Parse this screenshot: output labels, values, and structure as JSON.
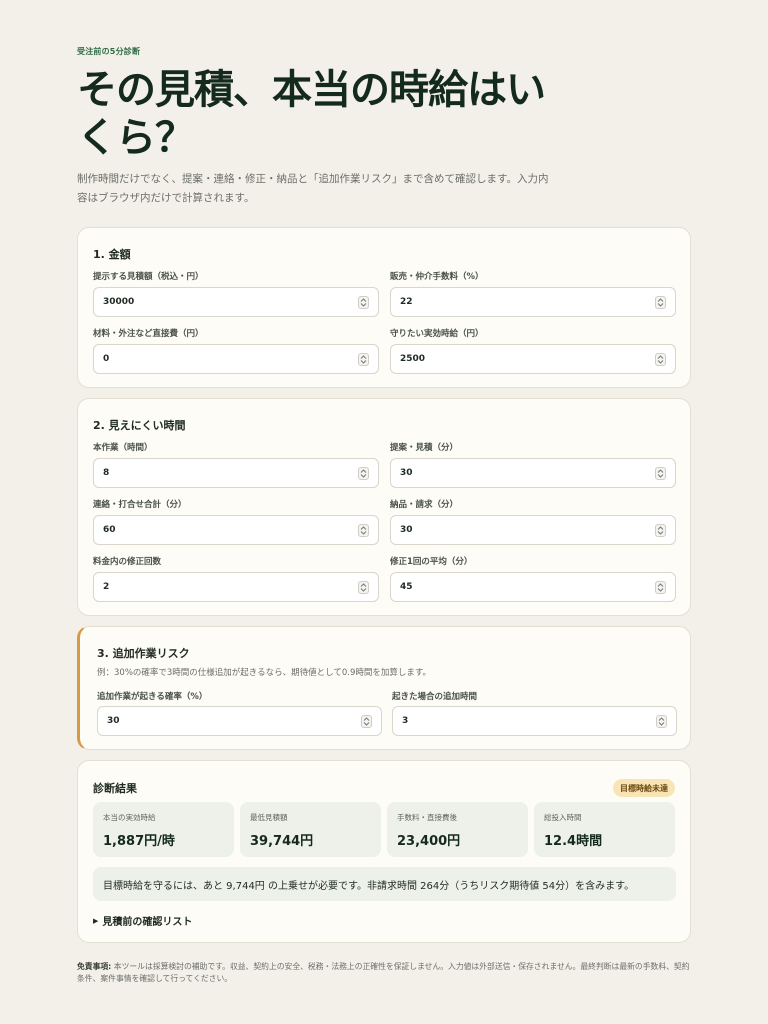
{
  "header": {
    "eyebrow": "受注前の5分診断",
    "title": "その見積、本当の時給はいくら？",
    "lead": "制作時間だけでなく、提案・連絡・修正・納品と「追加作業リスク」まで含めて確認します。入力内容はブラウザ内だけで計算されます。"
  },
  "section1": {
    "title": "1. 金額",
    "fields": [
      {
        "label": "提示する見積額（税込・円）",
        "value": "30000"
      },
      {
        "label": "販売・仲介手数料（%）",
        "value": "22"
      },
      {
        "label": "材料・外注など直接費（円）",
        "value": "0"
      },
      {
        "label": "守りたい実効時給（円）",
        "value": "2500"
      }
    ]
  },
  "section2": {
    "title": "2. 見えにくい時間",
    "fields": [
      {
        "label": "本作業（時間）",
        "value": "8"
      },
      {
        "label": "提案・見積（分）",
        "value": "30"
      },
      {
        "label": "連絡・打合せ合計（分）",
        "value": "60"
      },
      {
        "label": "納品・請求（分）",
        "value": "30"
      },
      {
        "label": "料金内の修正回数",
        "value": "2"
      },
      {
        "label": "修正1回の平均（分）",
        "value": "45"
      }
    ]
  },
  "section3": {
    "title": "3. 追加作業リスク",
    "note": "例：30%の確率で3時間の仕様追加が起きるなら、期待値として0.9時間を加算します。",
    "fields": [
      {
        "label": "追加作業が起きる確率（%）",
        "value": "30"
      },
      {
        "label": "起きた場合の追加時間",
        "value": "3"
      }
    ],
    "accent_color": "#d49a45"
  },
  "result": {
    "title": "診断結果",
    "badge": "目標時給未達",
    "metrics": [
      {
        "label": "本当の実効時給",
        "value": "1,887円/時"
      },
      {
        "label": "最低見積額",
        "value": "39,744円"
      },
      {
        "label": "手数料・直接費後",
        "value": "23,400円"
      },
      {
        "label": "総投入時間",
        "value": "12.4時間"
      }
    ],
    "summary": "目標時給を守るには、あと 9,744円 の上乗せが必要です。非請求時間 264分（うちリスク期待値 54分）を含みます。",
    "details_label": "見積前の確認リスト"
  },
  "disclaimer": {
    "label": "免責事項:",
    "text": "本ツールは採算検討の補助です。収益、契約上の安全、税務・法務上の正確性を保証しません。入力値は外部送信・保存されません。最終判断は最新の手数料、契約条件、案件事情を確認して行ってください。"
  }
}
